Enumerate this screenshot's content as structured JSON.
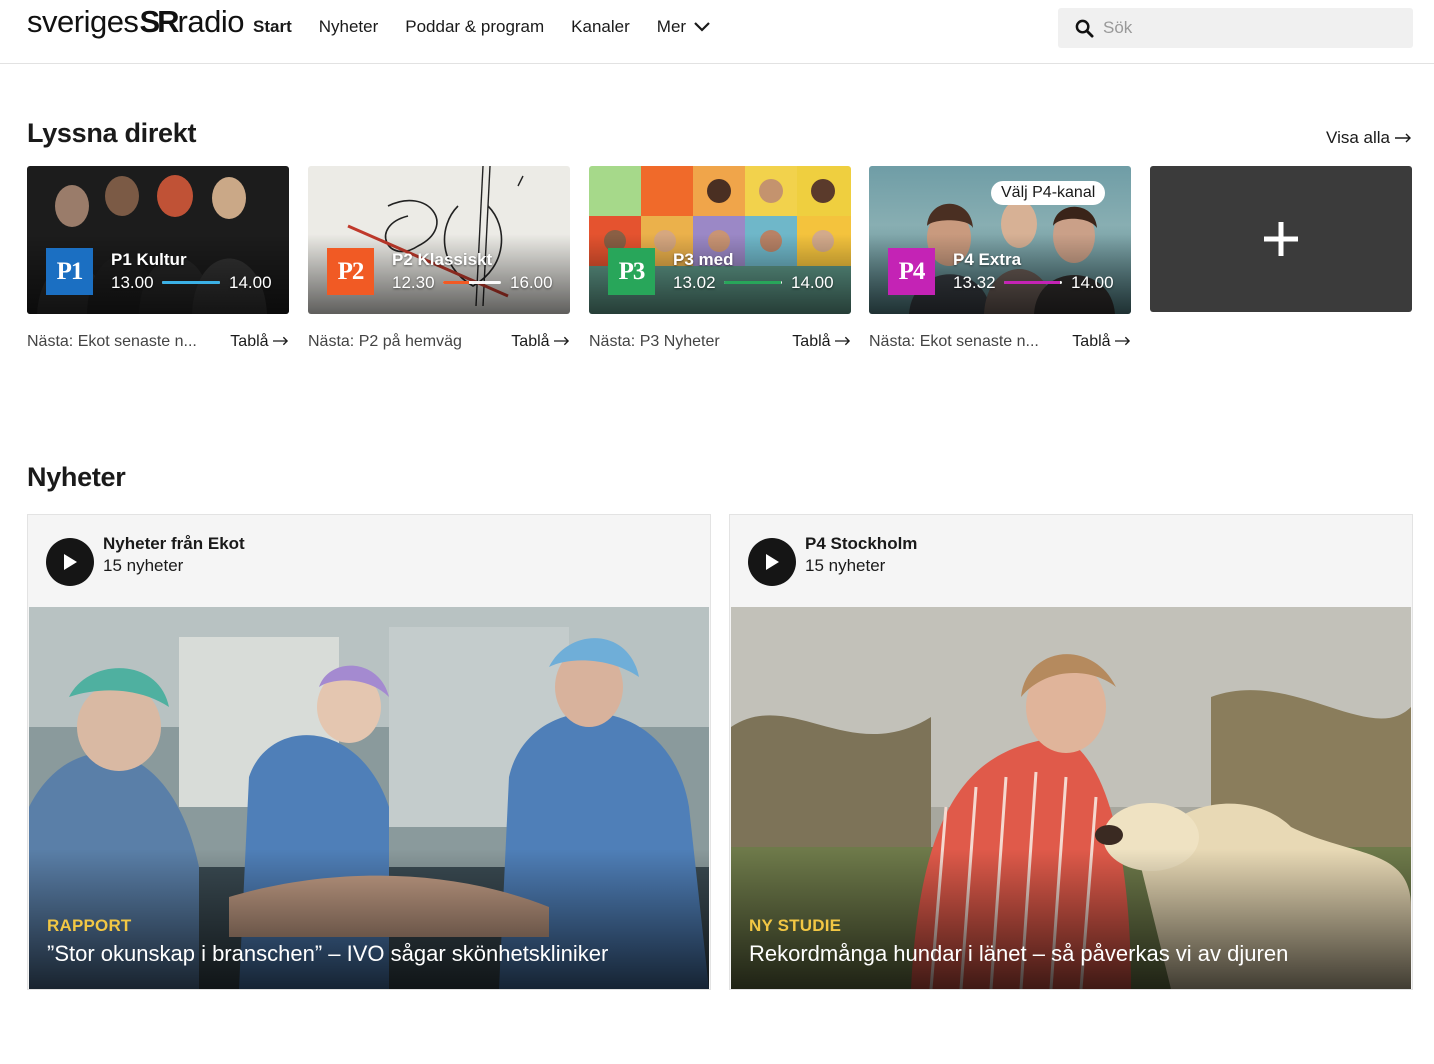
{
  "header": {
    "logo": {
      "left": "sveriges",
      "mark": "SR",
      "right": "radio"
    },
    "nav": [
      {
        "label": "Start",
        "active": true
      },
      {
        "label": "Nyheter"
      },
      {
        "label": "Poddar & program"
      },
      {
        "label": "Kanaler"
      },
      {
        "label": "Mer"
      }
    ],
    "search_placeholder": "Sök"
  },
  "live": {
    "title": "Lyssna direkt",
    "see_all": "Visa alla",
    "channels": [
      {
        "logo": "P1",
        "name": "P1 Kultur",
        "start": "13.00",
        "end": "14.00",
        "progress": 1.0,
        "color": "#1b6fc2",
        "bar_color": "#3bb1e6",
        "next": "Nästa: Ekot senaste n...",
        "schedule": "Tablå"
      },
      {
        "logo": "P2",
        "name": "P2 Klassiskt",
        "start": "12.30",
        "end": "16.00",
        "progress": 0.45,
        "color": "#f15a24",
        "bar_color": "#f15a24",
        "next": "Nästa: P2 på hemväg",
        "schedule": "Tablå"
      },
      {
        "logo": "P3",
        "name": "P3 med",
        "start": "13.02",
        "end": "14.00",
        "progress": 0.98,
        "color": "#28a65a",
        "bar_color": "#28a65a",
        "next": "Nästa: P3 Nyheter",
        "schedule": "Tablå"
      },
      {
        "logo": "P4",
        "name": "P4 Extra",
        "start": "13.32",
        "end": "14.00",
        "progress": 0.96,
        "color": "#c423b5",
        "bar_color": "#c423b5",
        "next": "Nästa: Ekot senaste n...",
        "schedule": "Tablå",
        "choose": "Välj P4-kanal"
      }
    ]
  },
  "news": {
    "title": "Nyheter",
    "cards": [
      {
        "source": "Nyheter från Ekot",
        "count": "15 nyheter",
        "tag": "RAPPORT",
        "headline": "”Stor okunskap i branschen” – IVO sågar skönhetskliniker"
      },
      {
        "source": "P4 Stockholm",
        "count": "15 nyheter",
        "tag": "NY STUDIE",
        "headline": "Rekordmånga hundar i länet – så påverkas vi av djuren"
      }
    ]
  }
}
